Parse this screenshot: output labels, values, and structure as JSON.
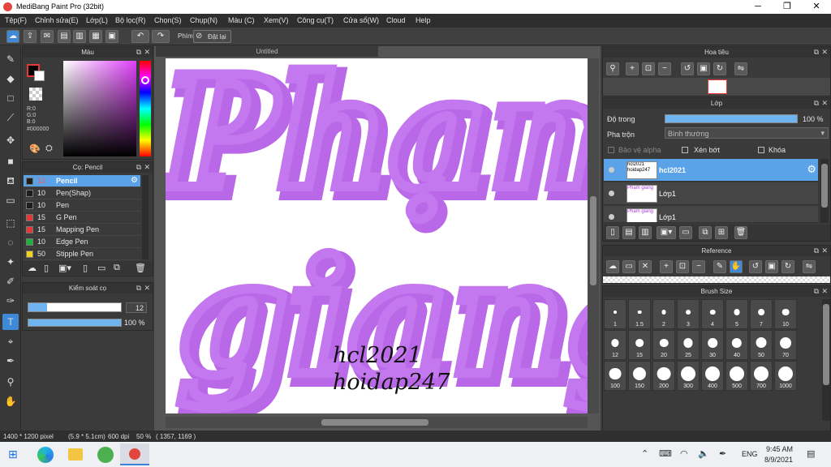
{
  "window": {
    "title": "MediBang Paint Pro (32bit)"
  },
  "menu": [
    "Tệp(F)",
    "Chỉnh sửa(E)",
    "Lớp(L)",
    "Bộ lọc(R)",
    "Chọn(S)",
    "Chụp(N)",
    "Màu (C)",
    "Xem(V)",
    "Công cụ(T)",
    "Cửa sổ(W)",
    "Cloud",
    "Help"
  ],
  "toolbar": {
    "key_label": "Phím",
    "reset_label": "Đặt lại"
  },
  "color_panel": {
    "title": "Màu",
    "r": "R:0",
    "g": "G:0",
    "b": "B:0",
    "hex": "#000000"
  },
  "brush_panel": {
    "title": "Cọ: Pencil",
    "items": [
      {
        "size": "12",
        "name": "Pencil",
        "color": "#1e1e1e"
      },
      {
        "size": "10",
        "name": "Pen(Shap)",
        "color": "#1e1e1e"
      },
      {
        "size": "10",
        "name": "Pen",
        "color": "#1e1e1e"
      },
      {
        "size": "15",
        "name": "G Pen",
        "color": "#e53935"
      },
      {
        "size": "15",
        "name": "Mapping Pen",
        "color": "#e53935"
      },
      {
        "size": "10",
        "name": "Edge Pen",
        "color": "#1db33b"
      },
      {
        "size": "50",
        "name": "Stipple Pen",
        "color": "#f2d21b"
      }
    ]
  },
  "stabilizer": {
    "title": "Kiểm soát cọ",
    "value": "12",
    "opacity": "100 %",
    "value_level": 0.2,
    "opacity_level": 1.0
  },
  "canvas": {
    "tab": "Untitled",
    "line1": "hcl2021",
    "line2": "hoidap247",
    "word1": "Phạm",
    "word2": "giang"
  },
  "navigator": {
    "title": "Hoa tiêu"
  },
  "layer_panel": {
    "title": "Lớp",
    "opacity_label": "Độ trong",
    "opacity_value": "100 %",
    "opacity_level": 1.0,
    "blend_label": "Pha trộn",
    "blend_value": "Bình thường",
    "protect_alpha": "Bảo vệ alpha",
    "clipping": "Xén bớt",
    "lock": "Khóa",
    "layers": [
      {
        "name": "hcl2021",
        "thumb": "hcl2021 hoidap247",
        "selected": true
      },
      {
        "name": "Lớp1",
        "thumb": "Phạm giang",
        "selected": false
      },
      {
        "name": "Lớp1",
        "thumb": "Phạm giang",
        "selected": false
      }
    ]
  },
  "reference": {
    "title": "Reference"
  },
  "brush_size": {
    "title": "Brush Size",
    "sizes": [
      "1",
      "1.5",
      "2",
      "3",
      "4",
      "5",
      "7",
      "10",
      "12",
      "15",
      "20",
      "25",
      "30",
      "40",
      "50",
      "70",
      "100",
      "150",
      "200",
      "300",
      "400",
      "500",
      "700",
      "1000"
    ]
  },
  "status": {
    "size": "1400 * 1200 pixel",
    "cm": "(5.9 * 5.1cm)",
    "dpi": "600 dpi",
    "zoom": "50 %",
    "coords": "( 1357, 1169 )"
  },
  "taskbar": {
    "lang": "ENG",
    "time": "9:45 AM",
    "date": "8/9/2021"
  }
}
